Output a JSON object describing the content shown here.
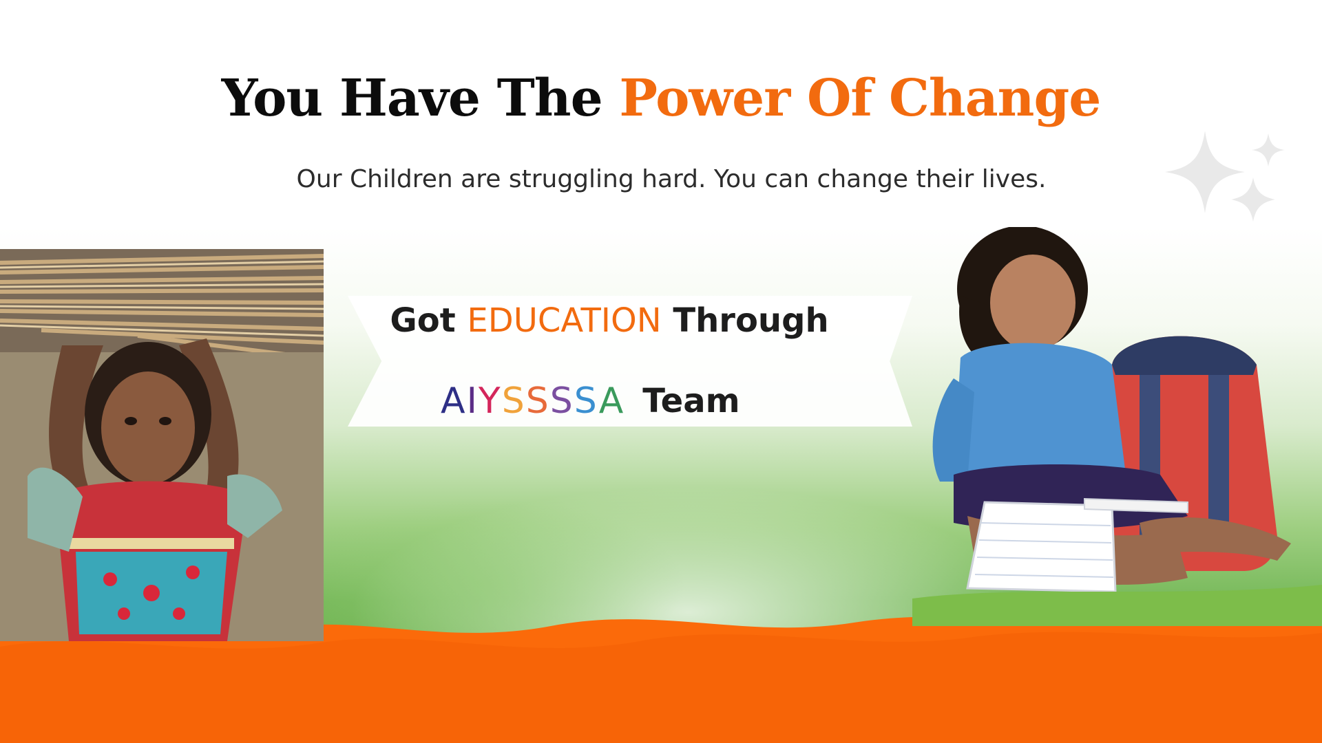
{
  "headline": {
    "part1": "You Have The",
    "part2": "Power Of Change"
  },
  "subtitle": "Our Children are struggling hard. You can change their lives.",
  "ribbon": {
    "prefix": "Got",
    "highlight": "EDUCATION",
    "suffix": "Through",
    "brand_letters": [
      {
        "char": "A",
        "color": "#2e2f86"
      },
      {
        "char": "I",
        "color": "#5b2d86"
      },
      {
        "char": "Y",
        "color": "#d4265b"
      },
      {
        "char": "S",
        "color": "#f0a23a"
      },
      {
        "char": "S",
        "color": "#e76a3a"
      },
      {
        "char": "S",
        "color": "#7b4fa0"
      },
      {
        "char": "S",
        "color": "#3a8fd0"
      },
      {
        "char": "A",
        "color": "#3a9a5c"
      }
    ],
    "team": "Team"
  },
  "colors": {
    "accent": "#f26b0f",
    "ground": "#fb6a0a",
    "meadow": "#7dbd60"
  }
}
